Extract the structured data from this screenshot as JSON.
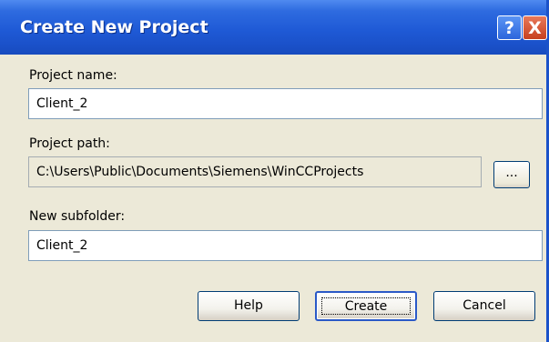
{
  "window": {
    "title": "Create New Project",
    "help_glyph": "?",
    "close_glyph": "X"
  },
  "form": {
    "project_name": {
      "label": "Project name:",
      "value": "Client_2"
    },
    "project_path": {
      "label": "Project path:",
      "value": "C:\\Users\\Public\\Documents\\Siemens\\WinCCProjects",
      "browse_label": "..."
    },
    "new_subfolder": {
      "label": "New subfolder:",
      "value": "Client_2"
    }
  },
  "buttons": {
    "help": "Help",
    "create": "Create",
    "cancel": "Cancel"
  },
  "colors": {
    "titlebar": "#1f5ad6",
    "dialog_bg": "#ece9d8",
    "close_button": "#c7401f"
  }
}
